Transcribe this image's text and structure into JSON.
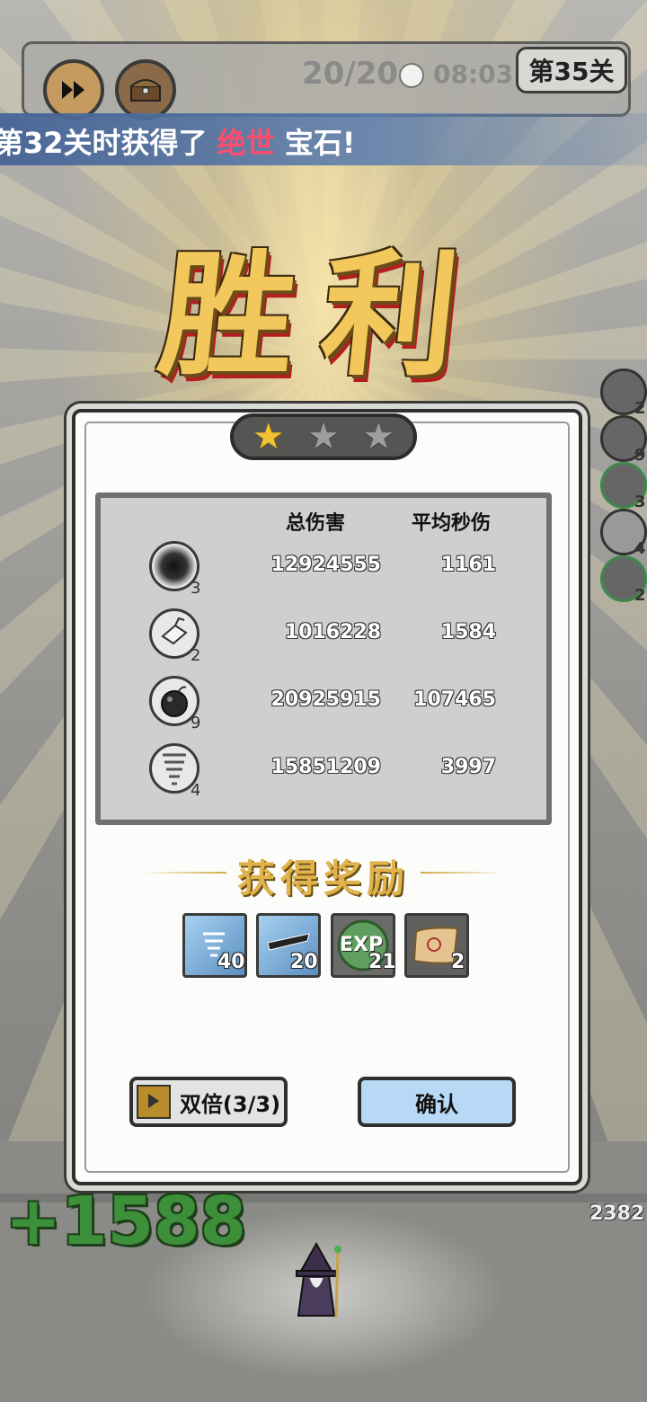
{
  "hud": {
    "wave": "20/20",
    "time": "08:03",
    "level": "第35关",
    "fast_forward_icon": "fast-forward-icon",
    "chest_icon": "treasure-chest-icon"
  },
  "banner": {
    "prefix": "第32关时获得了",
    "highlight": "绝世",
    "suffix": "宝石!"
  },
  "title": "胜利",
  "stars": {
    "earned": 1,
    "total": 3
  },
  "stats": {
    "col_total": "总伤害",
    "col_dps": "平均秒伤",
    "rows": [
      {
        "icon": "black-hole-skill-icon",
        "level": "3",
        "total": "12924555",
        "dps": "1161"
      },
      {
        "icon": "crystal-skill-icon",
        "level": "2",
        "total": "1016228",
        "dps": "1584"
      },
      {
        "icon": "bomb-skill-icon",
        "level": "9",
        "total": "20925915",
        "dps": "107465"
      },
      {
        "icon": "tornado-skill-icon",
        "level": "4",
        "total": "15851209",
        "dps": "3997"
      }
    ]
  },
  "rewards": {
    "title": "获得奖励",
    "items": [
      {
        "icon": "tornado-scroll-icon",
        "qty": "40",
        "color": "#6fa8dc"
      },
      {
        "icon": "sword-scroll-icon",
        "qty": "20",
        "color": "#6fa8dc"
      },
      {
        "icon": "exp-orb-icon",
        "label": "EXP",
        "qty": "21",
        "color": "#6aa06a"
      },
      {
        "icon": "map-scroll-icon",
        "qty": "2",
        "color": "#d9b07a"
      }
    ]
  },
  "buttons": {
    "double": "双倍(3/3)",
    "confirm": "确认"
  },
  "bottom": {
    "gain": "+1588",
    "hp": "2382"
  },
  "sidebar": {
    "slots": [
      {
        "icon": "crystal-skill-icon",
        "level": "2"
      },
      {
        "icon": "bomb-skill-icon",
        "level": "9"
      },
      {
        "icon": "black-hole-skill-icon",
        "level": "3"
      },
      {
        "icon": "tornado-skill-icon",
        "level": "4"
      },
      {
        "icon": "slash-skill-icon",
        "level": "2"
      }
    ]
  }
}
